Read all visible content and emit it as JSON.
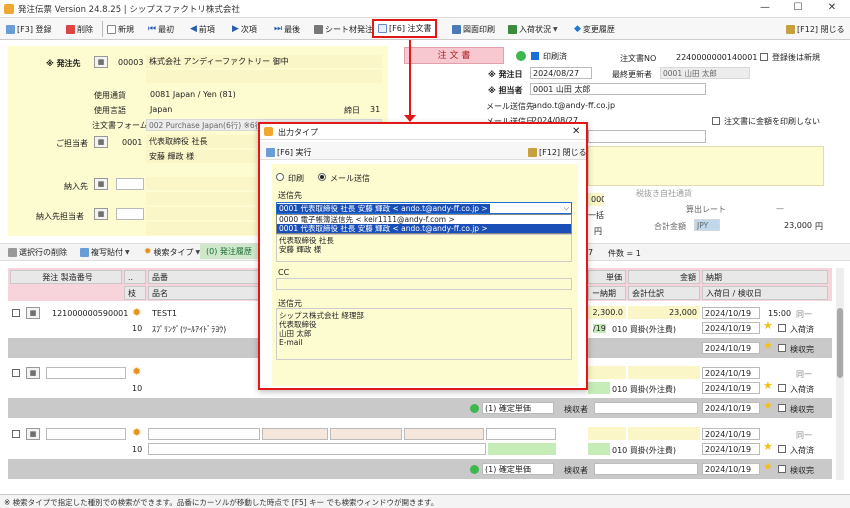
{
  "app": {
    "title": "発注伝票 Version 24.8.25 | シップスファクトリ株式会社",
    "min": "—",
    "max": "☐",
    "close": "✕"
  },
  "toolbar": {
    "register": "[F3] 登録",
    "delete": "削除",
    "new": "新規",
    "first": "最初",
    "prev": "前項",
    "next": "次項",
    "last": "最後",
    "sheet": "シート材発注",
    "order_form": "[F6] 注文書",
    "drawing": "図面印刷",
    "receive": "入荷状況",
    "history": "変更履歴",
    "close": "[F12] 閉じる"
  },
  "header": {
    "supplier_label": "※ 発注先",
    "supplier_code": "00003",
    "supplier_name": "株式会社 アンディーファクトリー 御中",
    "currency_label": "使用通貨",
    "currency_value": "0081 Japan / Yen (81)",
    "language_label": "使用言語",
    "language_value": "Japan",
    "cutoff_label": "締日",
    "cutoff_value": "31",
    "form_label": "注文書フォーム",
    "form_value": "002 Purchase Japan(6行) ※6行",
    "contact_label": "ご担当者",
    "contact_code": "0001",
    "contact_title": "代表取締役 社長",
    "contact_name": "安藤 輝政 様",
    "delivery_label": "納入先",
    "delivery_contact_label": "納入先担当者",
    "order_form_badge": "注 文 書",
    "print_done": "印刷済",
    "order_no_label": "注文書NO",
    "order_no": "2240000000140001",
    "register_new": "登録後は新規",
    "order_date_label": "※ 発注日",
    "order_date": "2024/08/27",
    "updater_label": "最終更新者",
    "updater": "0001 山田 太郎",
    "staff_label": "※ 担当者",
    "staff": "0001 山田 太郎",
    "mail_from_label": "メール送信先",
    "mail_from": "ando.t@andy-ff.co.jp",
    "mail_date_label": "メール送信日",
    "mail_date": "2024/08/27",
    "no_amount": "注文書に金額を印刷しない",
    "tax_section": "税抜き自社通貨",
    "calc_rate": "算出レート",
    "calc_rate_value": "—",
    "total_label": "合計金額",
    "total_currency": "JPY",
    "total_value": "23,000",
    "total_unit": "円",
    "left_amount": "000",
    "left_one": "一括",
    "left_yen": "円"
  },
  "lines_toolbar": {
    "delete_row": "選択行の削除",
    "copy": "複写貼付",
    "search_type": "検索タイプ",
    "history": "(0) 発注履歴",
    "count": "件数 = 1",
    "sub_count": "7"
  },
  "grid": {
    "h1": [
      "発注 製造番号",
      "..",
      "品番",
      "単価",
      "金額",
      "納期"
    ],
    "h2": [
      "枝",
      "品名",
      "ー納期",
      "会計仕訳",
      "入荷日 / 検収日"
    ],
    "rows": [
      {
        "order_no": "121000000590001",
        "branch": "10",
        "code": "TEST1",
        "name": "ｽﾌﾟﾘﾝｸﾞ(ﾂｰﾙｱｲﾄﾞﾗﾖｳ)",
        "price": "2,300.0",
        "amount": "23,000",
        "due": "2024/10/19",
        "time": "15:00",
        "same": "同一",
        "date2": "2024/10/19",
        "cost": "010 買掛(外注費)",
        "recv": "入荷済",
        "recv_date": "2024/10/19",
        "inspect": "検収完",
        "mini": "/19"
      },
      {
        "branch": "10",
        "cost": "010 買掛(外注費)",
        "due": "2024/10/19",
        "same": "同一",
        "recv": "入荷済",
        "recv_date": "2024/10/19",
        "inspect": "検収完",
        "confirm": "(1) 確定単価",
        "inspector": "検収者"
      },
      {
        "branch": "10",
        "cost": "010 買掛(外注費)",
        "due": "2024/10/19",
        "same": "同一",
        "recv": "入荷済",
        "recv_date": "2024/10/19",
        "inspect": "検収完",
        "confirm": "(1) 確定単価",
        "inspector": "検収者"
      }
    ]
  },
  "dialog": {
    "title": "出力タイプ",
    "run": "[F6] 実行",
    "close": "[F12] 閉じる",
    "print": "印刷",
    "mail": "メール送信",
    "to_label": "送信先",
    "to_selected": "0001 代表取締役 社長 安藤 輝政 < ando.t@andy-ff.co.jp >",
    "options": [
      "0000 電子帳簿送信先 < keir1111@andy-f.com >",
      "0001 代表取締役 社長 安藤 輝政 < ando.t@andy-ff.co.jp >"
    ],
    "body_line1": "代表取締役 社長",
    "body_line2": "安藤 輝政 様",
    "cc_label": "CC",
    "from_label": "送信元",
    "from_lines": [
      "シップス株式会社 経理部",
      "代表取締役",
      "山田 太郎",
      "E-mail"
    ]
  },
  "status": "※ 検索タイプで指定した種別での検索ができます。品番にカーソルが移動した時点で [F5] キー でも検索ウィンドウが開きます。"
}
